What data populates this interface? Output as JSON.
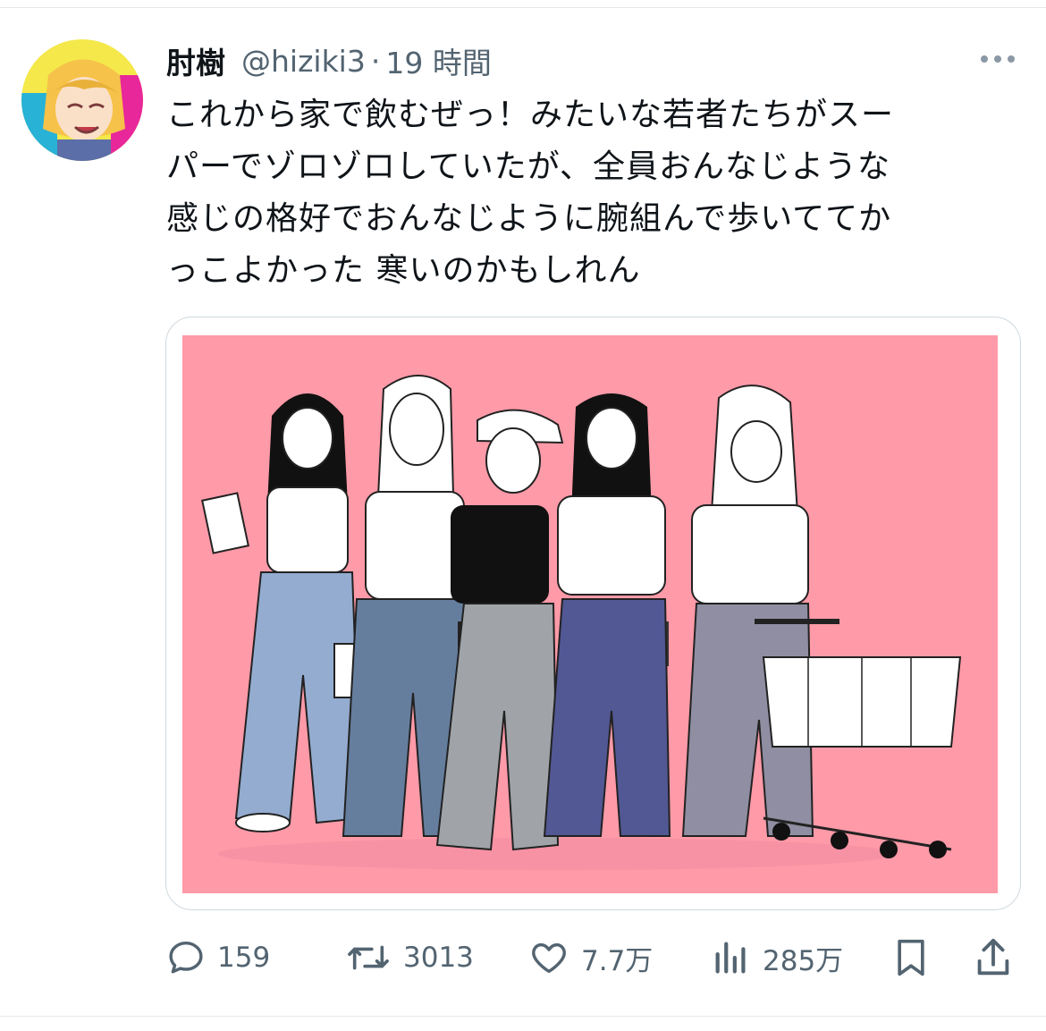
{
  "tweet": {
    "author_name": "肘樹",
    "handle": "@hiziki3",
    "separator": "·",
    "time": "19 時間",
    "text_lines": [
      "これから家で飲むぜっ！みたいな若者たちがスー",
      "パーでゾロゾロしていたが、全員おんなじような",
      "感じの格好でおんなじように腕組んで歩いててか",
      "っこよかった  寒いのかもしれん"
    ]
  },
  "media": {
    "icon": "illustration-image",
    "background": "#ff9aa8",
    "description_none": ""
  },
  "actions": {
    "reply_count": "159",
    "retweet_count": "3013",
    "like_count": "7.7万",
    "views_count": "285万"
  },
  "colors": {
    "text": "#0f1419",
    "secondary": "#536471",
    "divider": "#e6e9ec",
    "media_pink": "#ff9aa8"
  },
  "icons": [
    "more-icon",
    "reply-icon",
    "retweet-icon",
    "like-icon",
    "views-icon",
    "bookmark-icon",
    "share-icon"
  ]
}
